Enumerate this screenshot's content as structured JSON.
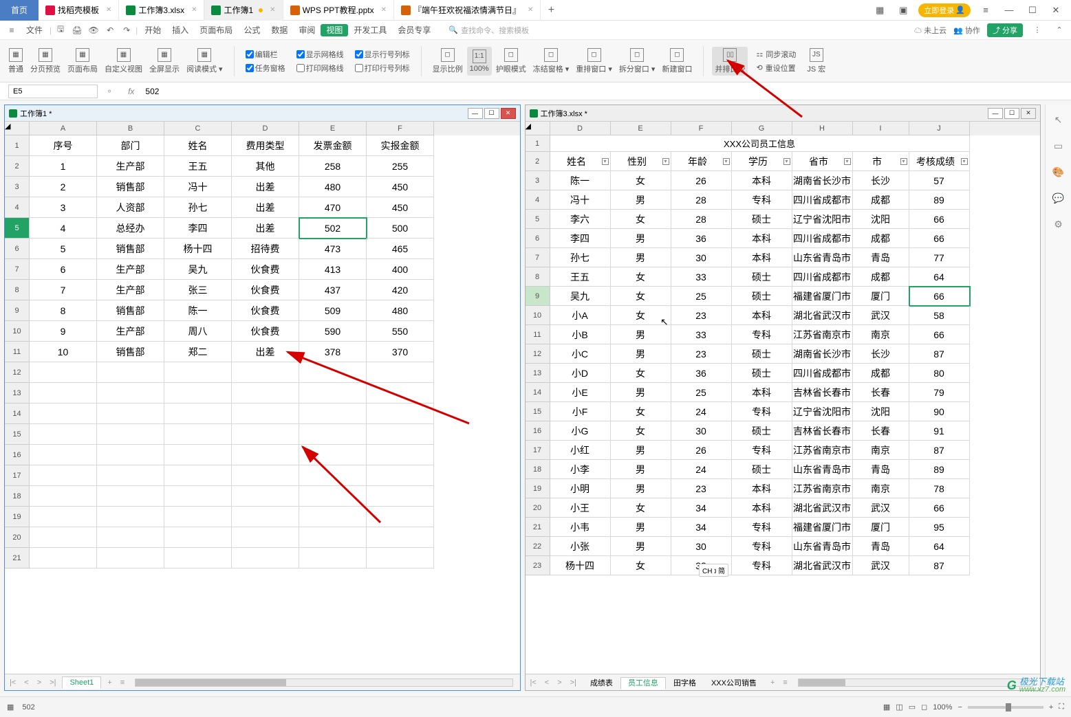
{
  "topbar": {
    "home": "首页",
    "tabs": [
      {
        "label": "找稻壳模板",
        "icon": "red"
      },
      {
        "label": "工作簿3.xlsx",
        "icon": "green"
      },
      {
        "label": "工作簿1",
        "icon": "green",
        "active": true,
        "dirty": true
      },
      {
        "label": "WPS PPT教程.pptx",
        "icon": "orange"
      },
      {
        "label": "『端午狂欢祝福浓情满节日』",
        "icon": "orange"
      }
    ],
    "login": "立即登录"
  },
  "menu": {
    "file": "文件",
    "items": [
      "开始",
      "插入",
      "页面布局",
      "公式",
      "数据",
      "审阅",
      "视图",
      "开发工具",
      "会员专享"
    ],
    "active": "视图",
    "search_ph": "查找命令、搜索模板",
    "cloud": "未上云",
    "coop": "协作",
    "share": "分享"
  },
  "ribbon": {
    "btns1": [
      "普通",
      "分页预览",
      "页面布局",
      "自定义视图",
      "全屏显示",
      "阅读模式"
    ],
    "chk1": [
      {
        "label": "编辑栏",
        "checked": true
      },
      {
        "label": "任务窗格",
        "checked": true
      }
    ],
    "chk2": [
      {
        "label": "显示网格线",
        "checked": true
      },
      {
        "label": "打印网格线",
        "checked": false
      }
    ],
    "chk3": [
      {
        "label": "显示行号列标",
        "checked": true
      },
      {
        "label": "打印行号列标",
        "checked": false
      }
    ],
    "btns2": [
      "显示比例",
      "100%",
      "护眼模式",
      "冻结窗格",
      "重排窗口",
      "拆分窗口",
      "新建窗口"
    ],
    "compare": "并排比较",
    "sync": "同步滚动",
    "reset": "重设位置",
    "js": "JS 宏"
  },
  "formula": {
    "cell": "E5",
    "fx": "fx",
    "value": "502"
  },
  "left_win": {
    "title": "工作簿1 *",
    "cols": [
      "A",
      "B",
      "C",
      "D",
      "E",
      "F"
    ],
    "header": [
      "序号",
      "部门",
      "姓名",
      "费用类型",
      "发票金额",
      "实报金额"
    ],
    "rows": [
      [
        "1",
        "生产部",
        "王五",
        "其他",
        "258",
        "255"
      ],
      [
        "2",
        "销售部",
        "冯十",
        "出差",
        "480",
        "450"
      ],
      [
        "3",
        "人资部",
        "孙七",
        "出差",
        "470",
        "450"
      ],
      [
        "4",
        "总经办",
        "李四",
        "出差",
        "502",
        "500"
      ],
      [
        "5",
        "销售部",
        "杨十四",
        "招待费",
        "473",
        "465"
      ],
      [
        "6",
        "生产部",
        "吴九",
        "伙食费",
        "413",
        "400"
      ],
      [
        "7",
        "生产部",
        "张三",
        "伙食费",
        "437",
        "420"
      ],
      [
        "8",
        "销售部",
        "陈一",
        "伙食费",
        "509",
        "480"
      ],
      [
        "9",
        "生产部",
        "周八",
        "伙食费",
        "590",
        "550"
      ],
      [
        "10",
        "销售部",
        "郑二",
        "出差",
        "378",
        "370"
      ]
    ],
    "active_row": 5,
    "active_col": 4,
    "sheet_tab": "Sheet1"
  },
  "right_win": {
    "title": "工作簿3.xlsx *",
    "banner": "XXX公司员工信息",
    "cols": [
      "D",
      "E",
      "F",
      "G",
      "H",
      "I",
      "J"
    ],
    "header": [
      "姓名",
      "性别",
      "年龄",
      "学历",
      "省市",
      "市",
      "考核成绩"
    ],
    "rows": [
      [
        "陈一",
        "女",
        "26",
        "本科",
        "湖南省长沙市",
        "长沙",
        "57"
      ],
      [
        "冯十",
        "男",
        "28",
        "专科",
        "四川省成都市",
        "成都",
        "89"
      ],
      [
        "李六",
        "女",
        "28",
        "硕士",
        "辽宁省沈阳市",
        "沈阳",
        "66"
      ],
      [
        "李四",
        "男",
        "36",
        "本科",
        "四川省成都市",
        "成都",
        "66"
      ],
      [
        "孙七",
        "男",
        "30",
        "本科",
        "山东省青岛市",
        "青岛",
        "77"
      ],
      [
        "王五",
        "女",
        "33",
        "硕士",
        "四川省成都市",
        "成都",
        "64"
      ],
      [
        "吴九",
        "女",
        "25",
        "硕士",
        "福建省厦门市",
        "厦门",
        "66"
      ],
      [
        "小A",
        "女",
        "23",
        "本科",
        "湖北省武汉市",
        "武汉",
        "58"
      ],
      [
        "小B",
        "男",
        "33",
        "专科",
        "江苏省南京市",
        "南京",
        "66"
      ],
      [
        "小C",
        "男",
        "23",
        "硕士",
        "湖南省长沙市",
        "长沙",
        "87"
      ],
      [
        "小D",
        "女",
        "36",
        "硕士",
        "四川省成都市",
        "成都",
        "80"
      ],
      [
        "小E",
        "男",
        "25",
        "本科",
        "吉林省长春市",
        "长春",
        "79"
      ],
      [
        "小F",
        "女",
        "24",
        "专科",
        "辽宁省沈阳市",
        "沈阳",
        "90"
      ],
      [
        "小G",
        "女",
        "30",
        "硕士",
        "吉林省长春市",
        "长春",
        "91"
      ],
      [
        "小红",
        "男",
        "26",
        "专科",
        "江苏省南京市",
        "南京",
        "87"
      ],
      [
        "小李",
        "男",
        "24",
        "硕士",
        "山东省青岛市",
        "青岛",
        "89"
      ],
      [
        "小明",
        "男",
        "23",
        "本科",
        "江苏省南京市",
        "南京",
        "78"
      ],
      [
        "小王",
        "女",
        "34",
        "本科",
        "湖北省武汉市",
        "武汉",
        "66"
      ],
      [
        "小韦",
        "男",
        "34",
        "专科",
        "福建省厦门市",
        "厦门",
        "95"
      ],
      [
        "小张",
        "男",
        "30",
        "专科",
        "山东省青岛市",
        "青岛",
        "64"
      ],
      [
        "杨十四",
        "女",
        "33",
        "专科",
        "湖北省武汉市",
        "武汉",
        "87"
      ]
    ],
    "row_start": 3,
    "hl_row": 9,
    "sheet_tabs": [
      "成绩表",
      "员工信息",
      "田字格",
      "XXX公司销售"
    ],
    "active_tab": "员工信息"
  },
  "status": {
    "val": "502",
    "zoom": "100%",
    "ime": "CH 🕽 简"
  },
  "watermark": {
    "brand": "极光下载站",
    "url": "www.xz7.com"
  }
}
